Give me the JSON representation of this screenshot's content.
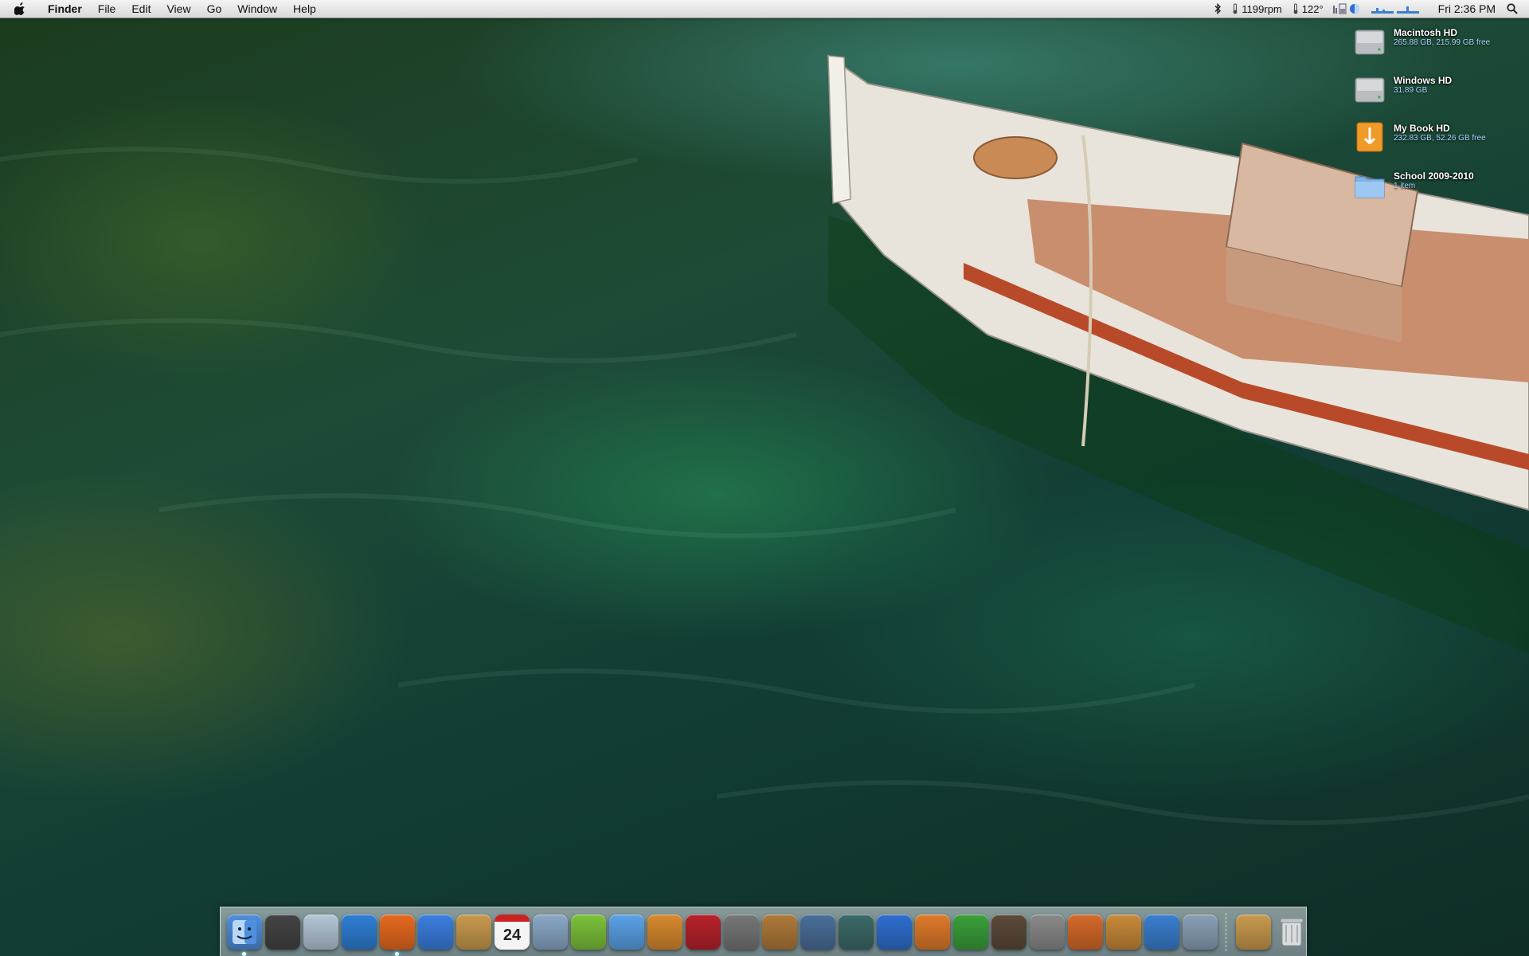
{
  "menubar": {
    "app_name": "Finder",
    "menus": [
      "File",
      "Edit",
      "View",
      "Go",
      "Window",
      "Help"
    ],
    "status": {
      "fan_speed": "1199rpm",
      "temperature": "122°",
      "clock": "Fri 2:36 PM"
    }
  },
  "desktop_icons": [
    {
      "name": "Macintosh HD",
      "info": "265.88 GB, 215.99 GB free",
      "icon": "hard-drive-icon"
    },
    {
      "name": "Windows HD",
      "info": "31.89 GB",
      "icon": "hard-drive-icon"
    },
    {
      "name": "My Book HD",
      "info": "232.83 GB, 52.26 GB free",
      "icon": "external-drive-icon"
    },
    {
      "name": "School 2009-2010",
      "info": "1 item",
      "icon": "folder-icon"
    }
  ],
  "dock": {
    "apps": [
      {
        "name": "finder-icon",
        "color": "#4f8fdc",
        "running": true
      },
      {
        "name": "dashboard-icon",
        "color": "#444444",
        "running": false
      },
      {
        "name": "mail-icon",
        "color": "#b5c7d8",
        "running": false
      },
      {
        "name": "safari-icon",
        "color": "#2e7fd6",
        "running": false
      },
      {
        "name": "firefox-icon",
        "color": "#e86a1f",
        "running": true
      },
      {
        "name": "ichat-icon",
        "color": "#3b7fe0",
        "running": false
      },
      {
        "name": "address-book-icon",
        "color": "#c99a4e",
        "running": false
      },
      {
        "name": "ical-icon",
        "color": "#f2f2f2",
        "calendar_day": "24",
        "running": false
      },
      {
        "name": "preview-icon",
        "color": "#8aa9c7",
        "running": false
      },
      {
        "name": "utorrent-icon",
        "color": "#7cc23a",
        "running": false
      },
      {
        "name": "itunes-icon",
        "color": "#5aa2e8",
        "running": false
      },
      {
        "name": "iphoto-icon",
        "color": "#d88a2e",
        "running": false
      },
      {
        "name": "photo-booth-icon",
        "color": "#b8222a",
        "running": false
      },
      {
        "name": "imovie-icon",
        "color": "#777777",
        "running": false
      },
      {
        "name": "garageband-icon",
        "color": "#b07a3a",
        "running": false
      },
      {
        "name": "spaces-icon",
        "color": "#4a6f9a",
        "running": false
      },
      {
        "name": "time-machine-icon",
        "color": "#3d6a6a",
        "running": false
      },
      {
        "name": "word-icon",
        "color": "#2f6fd0",
        "running": false
      },
      {
        "name": "powerpoint-icon",
        "color": "#e07a2a",
        "running": false
      },
      {
        "name": "excel-icon",
        "color": "#3aa03a",
        "running": false
      },
      {
        "name": "preferences-app-icon",
        "color": "#5c4a3a",
        "running": false
      },
      {
        "name": "system-preferences-icon",
        "color": "#8a8a8a",
        "running": false
      },
      {
        "name": "cocktail-icon",
        "color": "#d66a2a",
        "running": false
      },
      {
        "name": "keynote-icon",
        "color": "#c98a3a",
        "running": false
      },
      {
        "name": "numbers-icon",
        "color": "#3a7fd0",
        "running": false
      },
      {
        "name": "script-editor-icon",
        "color": "#8aa0b8",
        "running": false
      }
    ],
    "docs": [
      {
        "name": "documents-stack-icon",
        "color": "#c99a4e"
      },
      {
        "name": "trash-icon",
        "color": "#c0c4c8"
      }
    ]
  }
}
